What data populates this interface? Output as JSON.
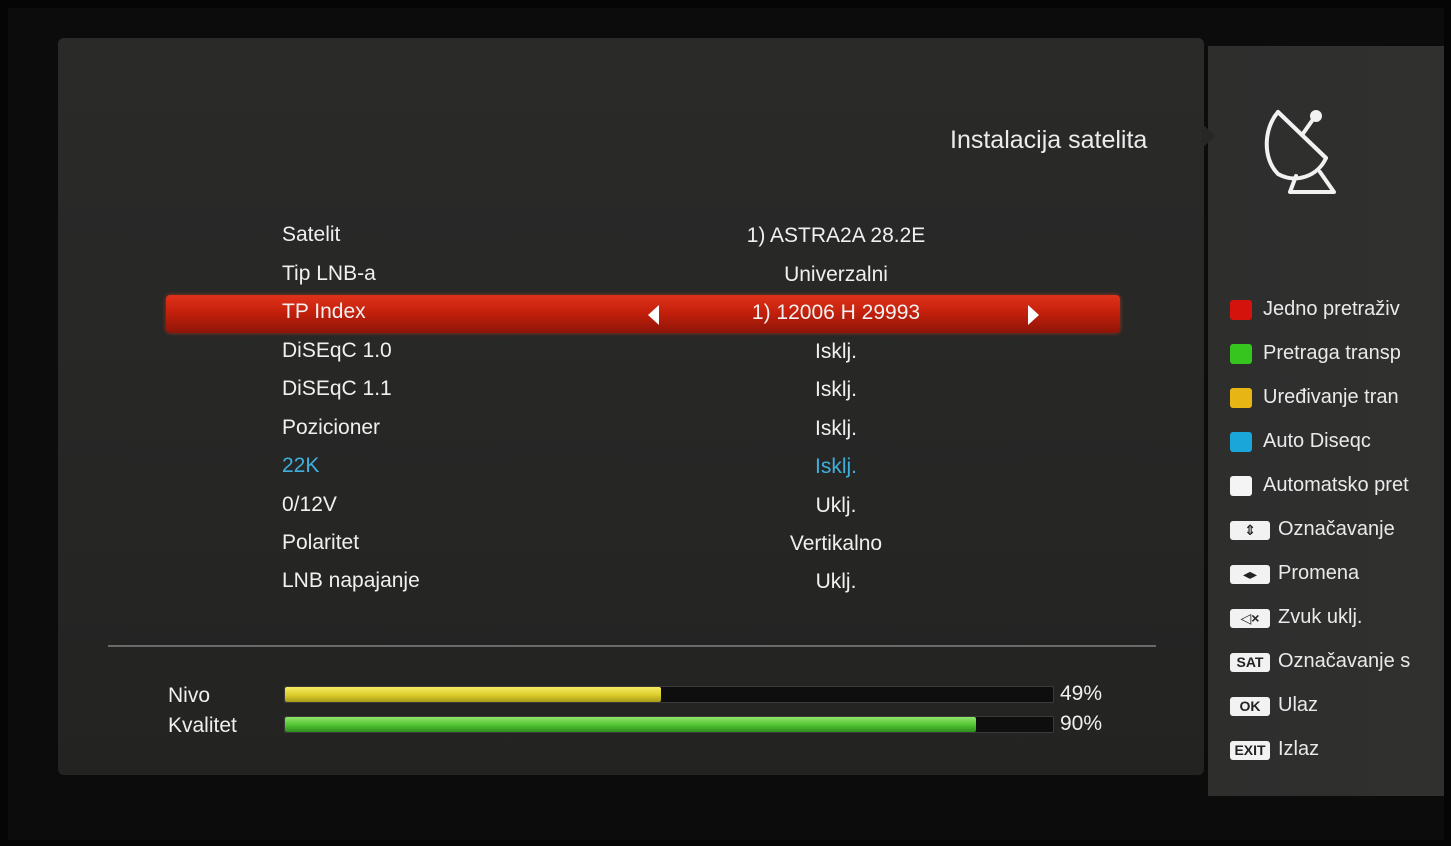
{
  "header": {
    "title": "Instalacija satelita",
    "icon": "satellite-dish-icon"
  },
  "settings": [
    {
      "label": "Satelit",
      "value": "1) ASTRA2A 28.2E"
    },
    {
      "label": "Tip LNB-a",
      "value": "Univerzalni"
    },
    {
      "label": "TP Index",
      "value": "1) 12006 H 29993",
      "selected": true
    },
    {
      "label": "DiSEqC 1.0",
      "value": "Isklj."
    },
    {
      "label": "DiSEqC 1.1",
      "value": "Isklj."
    },
    {
      "label": "Pozicioner",
      "value": "Isklj."
    },
    {
      "label": "22K",
      "value": "Isklj.",
      "highlight_color": "#3fb0de"
    },
    {
      "label": "0/12V",
      "value": "Uklj."
    },
    {
      "label": "Polaritet",
      "value": "Vertikalno"
    },
    {
      "label": "LNB napajanje",
      "value": "Uklj."
    }
  ],
  "signal": {
    "level": {
      "label": "Nivo",
      "percent_text": "49%",
      "value": 0.49,
      "color": "#e6dc3a"
    },
    "quality": {
      "label": "Kvalitet",
      "percent_text": "90%",
      "value": 0.9,
      "color": "#5ccf3a"
    }
  },
  "legend": [
    {
      "type": "color",
      "color": "#d4140c",
      "text": "Jedno pretraživ"
    },
    {
      "type": "color",
      "color": "#36c41e",
      "text": "Pretraga transp"
    },
    {
      "type": "color",
      "color": "#e8b614",
      "text": "Uređivanje tran"
    },
    {
      "type": "color",
      "color": "#1aa6d8",
      "text": "Auto Diseqc"
    },
    {
      "type": "color",
      "color": "#f4f4f4",
      "text": "Automatsko pret"
    },
    {
      "type": "key",
      "key": "⇕",
      "icon": "up-down-key-icon",
      "text": "Označavanje"
    },
    {
      "type": "key",
      "key": "◂▸",
      "icon": "left-right-key-icon",
      "text": "Promena"
    },
    {
      "type": "key",
      "key": "◁×",
      "icon": "mute-key-icon",
      "text": "Zvuk uklj."
    },
    {
      "type": "key",
      "key": "SAT",
      "icon": "sat-key-icon",
      "text": "Označavanje s"
    },
    {
      "type": "key",
      "key": "OK",
      "icon": "ok-key-icon",
      "text": "Ulaz"
    },
    {
      "type": "key",
      "key": "EXIT",
      "icon": "exit-key-icon",
      "text": "Izlaz"
    }
  ]
}
